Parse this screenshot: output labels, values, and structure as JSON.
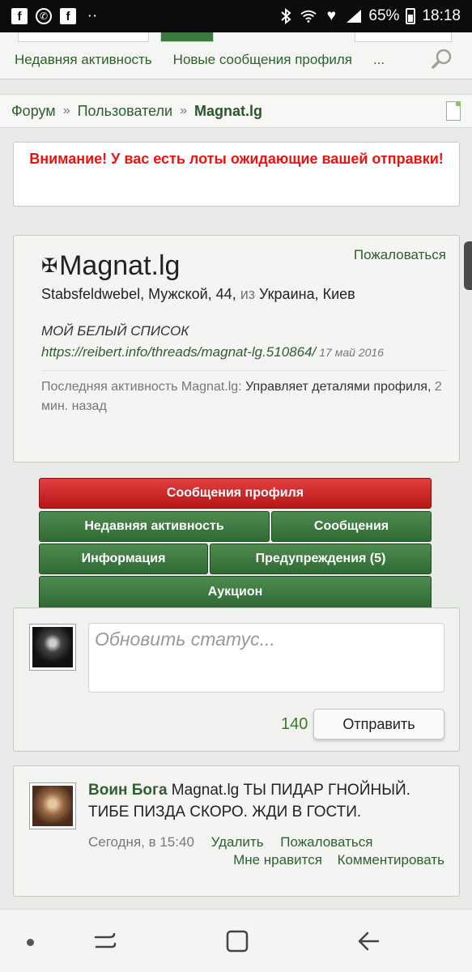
{
  "status_bar": {
    "battery": "65%",
    "time": "18:18"
  },
  "topnav": {
    "links": [
      "Недавняя активность",
      "Новые сообщения профиля",
      "..."
    ]
  },
  "breadcrumb": {
    "items": [
      "Форум",
      "Пользователи",
      "Magnat.lg"
    ],
    "separator": "»"
  },
  "alert": {
    "text": "Внимание! У вас есть лоты ожидающие вашей отправки!"
  },
  "profile": {
    "name": "Magnat.lg",
    "cross": "✠",
    "report_label": "Пожаловаться",
    "details_prefix": "Stabsfeldwebel, Мужской, 44,",
    "details_from": "из",
    "details_location": "Украина, Киев",
    "list_title": "МОЙ БЕЛЫЙ СПИСОК",
    "list_link": "https://reibert.info/threads/magnat-lg.510864/",
    "list_date": "17 май 2016",
    "activity_label": "Последняя активность Magnat.lg:",
    "activity_text": "Управляет деталями профиля,",
    "activity_time": "2 мин. назад"
  },
  "tabs": {
    "profile_posts": "Сообщения профиля",
    "recent_activity": "Недавняя активность",
    "messages": "Сообщения",
    "information": "Информация",
    "warnings": "Предупреждения (5)",
    "auction": "Аукцион"
  },
  "status_update": {
    "placeholder": "Обновить статус...",
    "counter": "140",
    "send_label": "Отправить"
  },
  "comment": {
    "author": "Воин Бога",
    "text": "Magnat.lg ТЫ ПИДАР ГНОЙНЫЙ. ТИБЕ ПИЗДА СКОРО. ЖДИ В ГОСТИ.",
    "time": "Сегодня, в 15:40",
    "delete_label": "Удалить",
    "report_label": "Пожаловаться",
    "like_label": "Мне нравится",
    "comment_label": "Комментировать"
  },
  "colors": {
    "link_green": "#2f5e2f",
    "tab_green": "#3a7a3e",
    "tab_red": "#cc2222",
    "alert_red": "#ee1111"
  }
}
